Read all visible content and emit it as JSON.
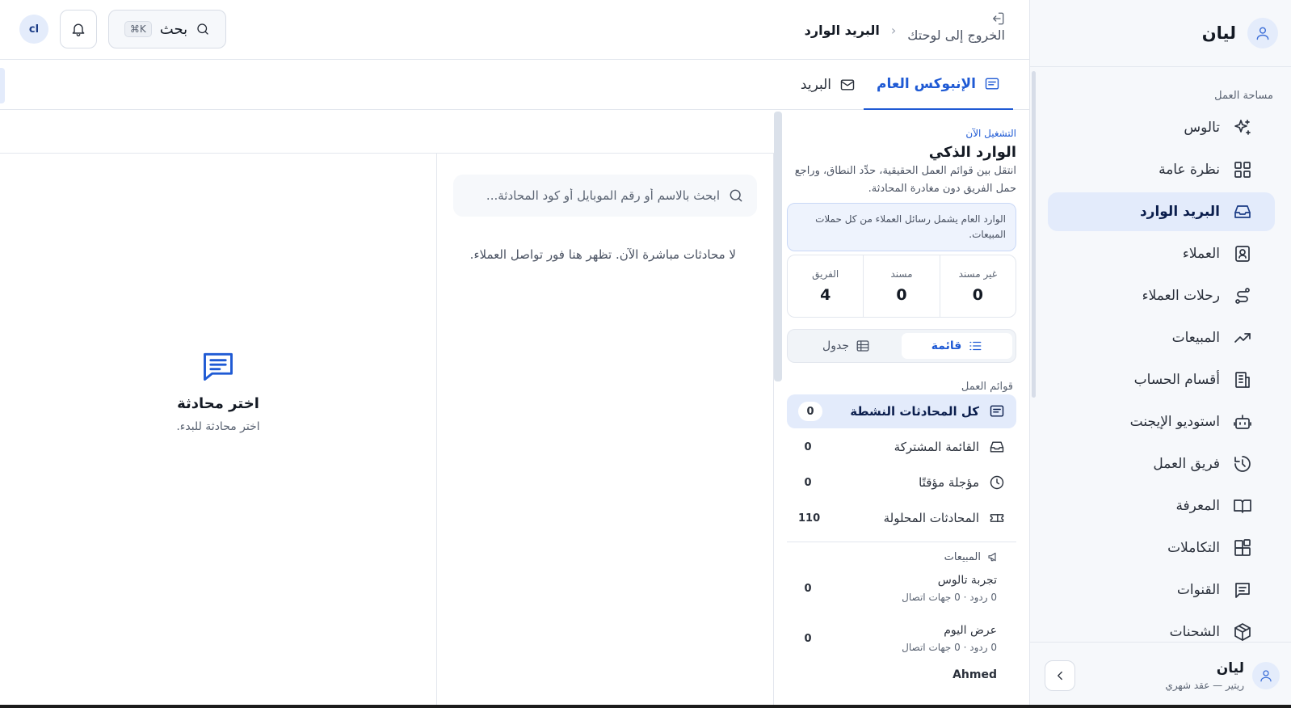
{
  "sidebar": {
    "brand": "ليان",
    "section_label": "مساحة العمل",
    "items": [
      {
        "label": "تالوس",
        "icon": "sparkles-icon"
      },
      {
        "label": "نظرة عامة",
        "icon": "grid-icon"
      },
      {
        "label": "البريد الوارد",
        "icon": "inbox-icon",
        "active": true
      },
      {
        "label": "العملاء",
        "icon": "contact-icon"
      },
      {
        "label": "رحلات العملاء",
        "icon": "route-icon"
      },
      {
        "label": "المبيعات",
        "icon": "trend-icon"
      },
      {
        "label": "أقسام الحساب",
        "icon": "building-icon"
      },
      {
        "label": "استوديو الإيجنت",
        "icon": "bot-icon"
      },
      {
        "label": "فريق العمل",
        "icon": "history-icon"
      },
      {
        "label": "المعرفة",
        "icon": "book-icon"
      },
      {
        "label": "التكاملات",
        "icon": "blocks-icon"
      },
      {
        "label": "القنوات",
        "icon": "message-icon"
      },
      {
        "label": "الشحنات",
        "icon": "package-icon"
      }
    ],
    "footer": {
      "name": "ليان",
      "plan": "ريتير — عقد شهري"
    }
  },
  "topbar": {
    "exit_label": "الخروج إلى لوحتك",
    "breadcrumb_current": "البريد الوارد",
    "search_label": "بحث",
    "search_shortcut": "⌘K",
    "user_initials": "cl"
  },
  "tabs": {
    "general": "الإنبوكس العام",
    "mail": "البريد"
  },
  "inbox_panel": {
    "eyebrow": "التشغيل الآن",
    "title": "الوارد الذكي",
    "description": "انتقل بين قوائم العمل الحقيقية، حدِّد النطاق، وراجع حمل الفريق دون مغادرة المحادثة.",
    "info": "الوارد العام يشمل رسائل العملاء من كل حملات المبيعات.",
    "stats": [
      {
        "label": "غير مسند",
        "value": "0"
      },
      {
        "label": "مسند",
        "value": "0"
      },
      {
        "label": "الفريق",
        "value": "4"
      }
    ],
    "view_list": "قائمة",
    "view_table": "جدول",
    "queues_label": "قوائم العمل",
    "queues": [
      {
        "label": "كل المحادثات النشطة",
        "count": "0"
      },
      {
        "label": "القائمة المشتركة",
        "count": "0"
      },
      {
        "label": "مؤجلة مؤقتًا",
        "count": "0"
      },
      {
        "label": "المحادثات المحلولة",
        "count": "110"
      }
    ],
    "campaigns_label": "المبيعات",
    "campaigns": [
      {
        "name": "تجربة تالوس",
        "meta": "0 ردود · 0 جهات اتصال",
        "count": "0"
      },
      {
        "name": "عرض اليوم",
        "meta": "0 ردود · 0 جهات اتصال",
        "count": "0"
      },
      {
        "name": "Ahmed"
      }
    ]
  },
  "conversations": {
    "search_placeholder": "ابحث بالاسم أو رقم الموبايل أو كود المحادثة...",
    "empty": "لا محادثات مباشرة الآن. تظهر هنا فور تواصل العملاء."
  },
  "detail": {
    "title": "اختر محادثة",
    "subtitle": "اختر محادثة للبدء."
  },
  "colors": {
    "accent": "#1f5ad4",
    "active_bg": "#e3ebfb",
    "sidebar_bg": "#f6f8fb"
  }
}
